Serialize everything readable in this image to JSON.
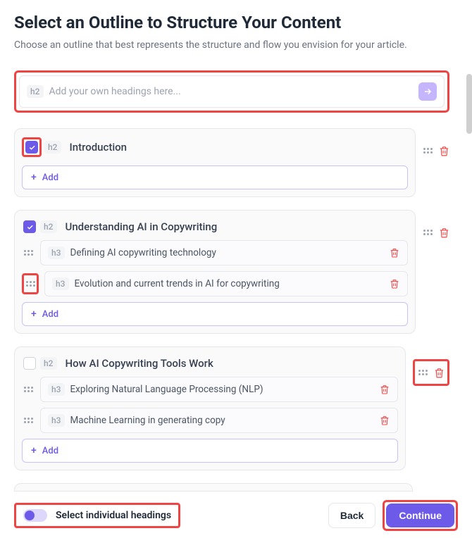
{
  "title": "Select an Outline to Structure Your Content",
  "subtitle": "Choose an outline that best represents the structure and flow you envision for your article.",
  "input": {
    "tag": "h2",
    "placeholder": "Add your own headings here..."
  },
  "sections": [
    {
      "checked": true,
      "tag": "h2",
      "title": "Introduction",
      "subs": [],
      "add_label": "Add",
      "checkbox_highlight": true,
      "side_highlight": false
    },
    {
      "checked": true,
      "tag": "h2",
      "title": "Understanding AI in Copywriting",
      "subs": [
        {
          "tag": "h3",
          "text": "Defining AI copywriting technology",
          "drag_highlight": false
        },
        {
          "tag": "h3",
          "text": "Evolution and current trends in AI for copywriting",
          "drag_highlight": true
        }
      ],
      "add_label": "Add",
      "checkbox_highlight": false,
      "side_highlight": false
    },
    {
      "checked": false,
      "tag": "h2",
      "title": "How AI Copywriting Tools Work",
      "subs": [
        {
          "tag": "h3",
          "text": "Exploring Natural Language Processing (NLP)",
          "drag_highlight": false
        },
        {
          "tag": "h3",
          "text": "Machine Learning in generating copy",
          "drag_highlight": false
        }
      ],
      "add_label": "Add",
      "checkbox_highlight": false,
      "side_highlight": true
    }
  ],
  "footer": {
    "toggle_label": "Select individual headings",
    "back": "Back",
    "continue": "Continue"
  }
}
